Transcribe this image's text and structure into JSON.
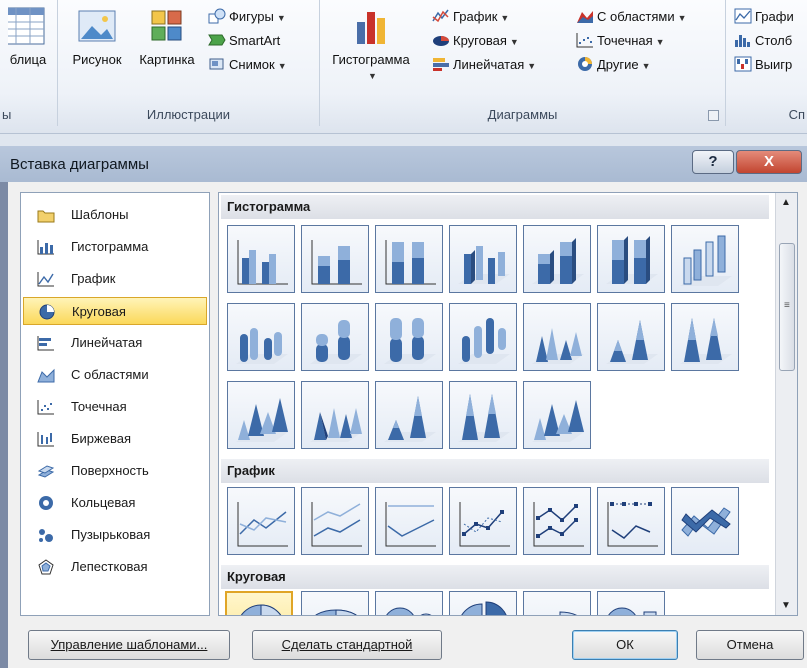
{
  "ribbon": {
    "cut_left": {
      "label": "блица",
      "group": "ы"
    },
    "illustrations": {
      "group_label": "Иллюстрации",
      "picture": "Рисунок",
      "clipart": "Картинка",
      "shapes": "Фигуры",
      "smartart": "SmartArt",
      "screenshot": "Снимок"
    },
    "charts": {
      "group_label": "Диаграммы",
      "column": "Гистограмма",
      "line": "График",
      "pie": "Круговая",
      "bar": "Линейчатая",
      "area": "С областями",
      "scatter": "Точечная",
      "other": "Другие"
    },
    "cut_right": {
      "line": "Графи",
      "column": "Столб",
      "winloss": "Выигр",
      "group": "Сп"
    }
  },
  "dialog": {
    "title": "Вставка диаграммы",
    "help_glyph": "?",
    "close_glyph": "X",
    "types": [
      {
        "label": "Шаблоны",
        "icon": "folder-icon"
      },
      {
        "label": "Гистограмма",
        "icon": "column-chart-icon"
      },
      {
        "label": "График",
        "icon": "line-chart-icon"
      },
      {
        "label": "Круговая",
        "icon": "pie-chart-icon"
      },
      {
        "label": "Линейчатая",
        "icon": "bar-chart-icon"
      },
      {
        "label": "С областями",
        "icon": "area-chart-icon"
      },
      {
        "label": "Точечная",
        "icon": "scatter-chart-icon"
      },
      {
        "label": "Биржевая",
        "icon": "stock-chart-icon"
      },
      {
        "label": "Поверхность",
        "icon": "surface-chart-icon"
      },
      {
        "label": "Кольцевая",
        "icon": "doughnut-chart-icon"
      },
      {
        "label": "Пузырьковая",
        "icon": "bubble-chart-icon"
      },
      {
        "label": "Лепестковая",
        "icon": "radar-chart-icon"
      }
    ],
    "selected_type": "Круговая",
    "sections": {
      "column": "Гистограмма",
      "line": "График",
      "pie": "Круговая"
    },
    "buttons": {
      "manage_templates": "Управление шаблонами...",
      "set_default": "Сделать стандартной",
      "ok": "ОК",
      "cancel": "Отмена"
    }
  }
}
